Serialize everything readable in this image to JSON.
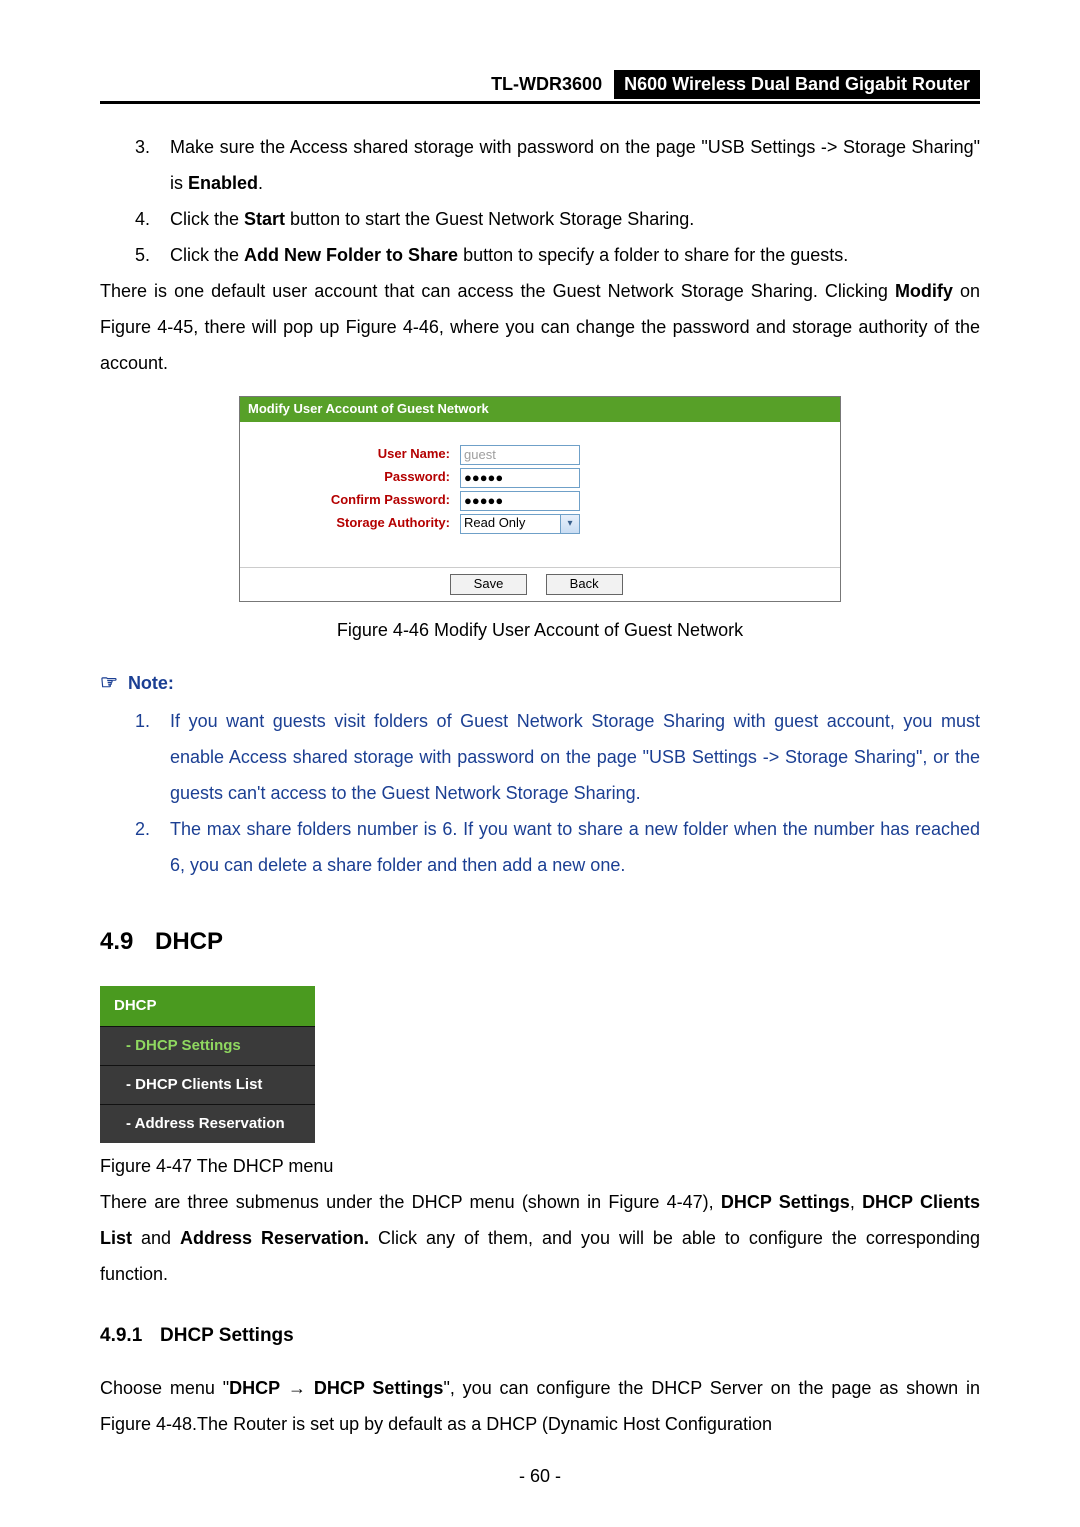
{
  "header": {
    "model": "TL-WDR3600",
    "desc": "N600 Wireless Dual Band Gigabit Router"
  },
  "top_list": [
    {
      "marker": "3.",
      "text_before_bold": "Make sure the Access shared storage with password on the page \"USB Settings -> Storage Sharing\" is ",
      "bold": "Enabled",
      "text_after_bold": "."
    },
    {
      "marker": "4.",
      "text_before_bold": "Click the ",
      "bold": "Start",
      "text_after_bold": " button to start the Guest Network Storage Sharing."
    },
    {
      "marker": "5.",
      "text_before_bold": "Click the ",
      "bold": "Add New Folder to Share",
      "text_after_bold": " button to specify a folder to share for the guests."
    }
  ],
  "para1_before_bold": "There is one default user account that can access the Guest Network Storage Sharing. Clicking ",
  "para1_bold": "Modify",
  "para1_after_bold": " on Figure 4-45, there will pop up Figure 4-46, where you can change the password and storage authority of the account.",
  "modify": {
    "title": "Modify User Account of Guest Network",
    "username_label": "User Name:",
    "password_label": "Password:",
    "confirm_label": "Confirm Password:",
    "storage_label": "Storage Authority:",
    "username_value": "guest",
    "pw_mask": "●●●●●",
    "storage_value": "Read Only",
    "save": "Save",
    "back": "Back"
  },
  "caption1": "Figure 4-46 Modify User Account of Guest Network",
  "note_label": "Note:",
  "note_list": [
    {
      "marker": "1.",
      "text": "If you want guests visit folders of Guest Network Storage Sharing with guest account, you must enable Access shared storage with password on the page \"USB Settings -> Storage Sharing\", or the guests can't access to the Guest Network Storage Sharing."
    },
    {
      "marker": "2.",
      "text": "The max share folders number is 6. If you want to share a new folder when the number has reached 6, you can delete a share folder and then add a new one."
    }
  ],
  "sec49_num": "4.9",
  "sec49_title": "DHCP",
  "dhcp_menu": {
    "header": "DHCP",
    "items": [
      "- DHCP Settings",
      "- DHCP Clients List",
      "- Address Reservation"
    ]
  },
  "caption2": "Figure 4-47 The DHCP menu",
  "para2_seg1": "There are three submenus under the DHCP menu (shown in Figure 4-47), ",
  "para2_bold1": "DHCP Settings",
  "para2_seg2": ", ",
  "para2_bold2": "DHCP Clients List",
  "para2_seg3": " and ",
  "para2_bold3": "Address Reservation.",
  "para2_seg4": " Click any of them, and you will be able to configure the corresponding function.",
  "sec491_num": "4.9.1",
  "sec491_title": "DHCP Settings",
  "para3_seg1": "Choose menu \"",
  "para3_bold1": "DHCP",
  "para3_arrow": " → ",
  "para3_bold2": "DHCP Settings",
  "para3_seg2": "\", you can configure the DHCP Server on the page as shown in Figure 4-48.The Router is set up by default as a DHCP (Dynamic Host Configuration",
  "page_number": "- 60 -"
}
